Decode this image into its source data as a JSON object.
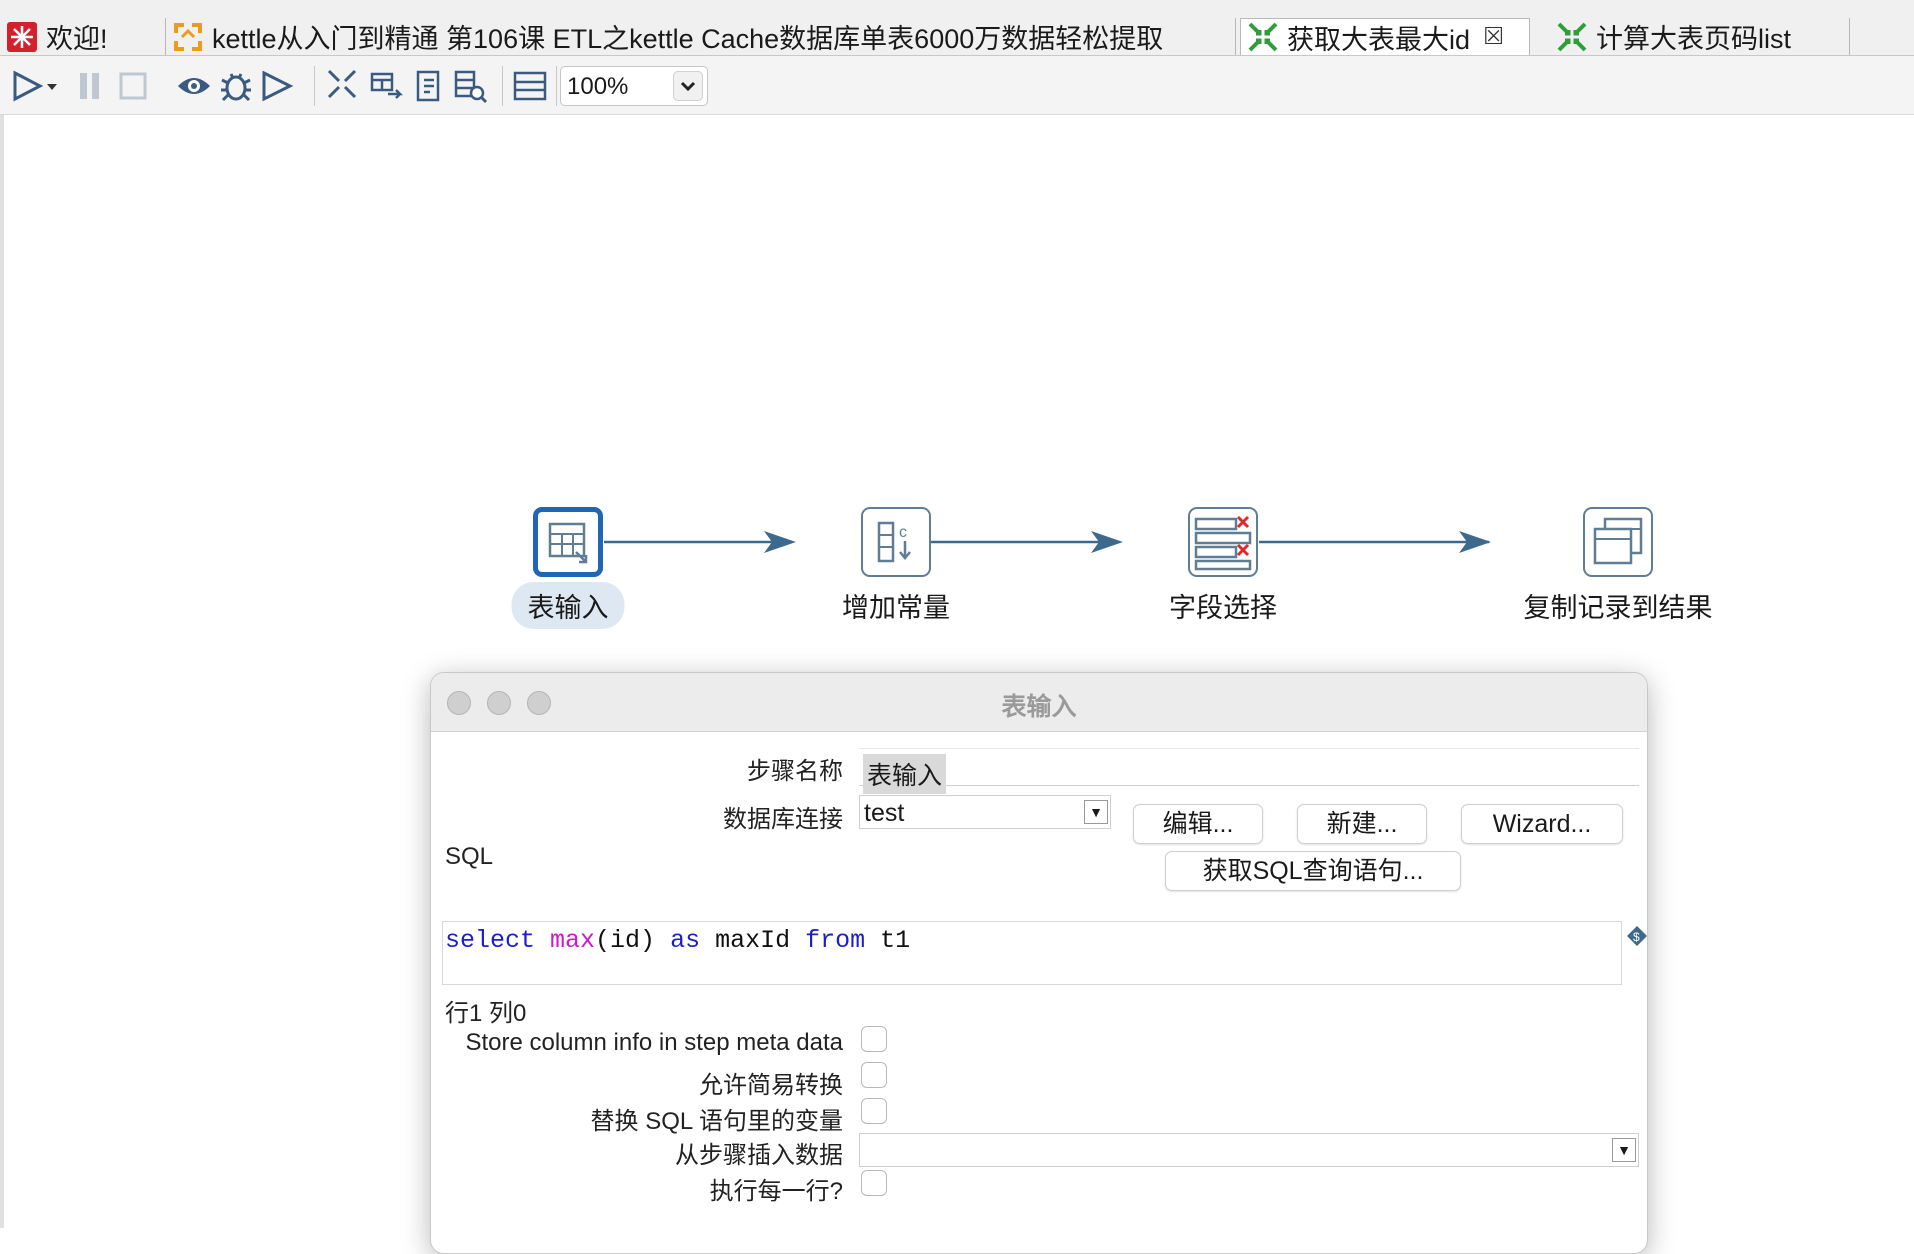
{
  "tabs": [
    {
      "label": "欢迎!",
      "icon": "spoon-welcome-icon"
    },
    {
      "label": "kettle从入门到精通 第106课 ETL之kettle Cache数据库单表6000万数据轻松提取",
      "icon": "job-icon"
    },
    {
      "label": "获取大表最大id",
      "icon": "transformation-icon",
      "active": true
    },
    {
      "label": "计算大表页码list",
      "icon": "transformation-icon"
    }
  ],
  "toolbar": {
    "zoom_value": "100%",
    "icons": [
      "run-icon",
      "dropdown-arrow-icon",
      "pause-icon",
      "stop-icon",
      "preview-icon",
      "debug-icon",
      "replay-icon",
      "verify-icon",
      "impact-icon",
      "generate-sql-icon",
      "explore-db-icon",
      "show-results-icon"
    ]
  },
  "canvas": {
    "steps": [
      {
        "label": "表输入",
        "icon": "table-input-icon",
        "selected": true
      },
      {
        "label": "增加常量",
        "icon": "add-constants-icon"
      },
      {
        "label": "字段选择",
        "icon": "select-values-icon"
      },
      {
        "label": "复制记录到结果",
        "icon": "copy-rows-to-result-icon"
      }
    ]
  },
  "dialog": {
    "title": "表输入",
    "step_name_label": "步骤名称",
    "step_name_value": "表输入",
    "db_conn_label": "数据库连接",
    "db_conn_value": "test",
    "edit_btn": "编辑...",
    "new_btn": "新建...",
    "wizard_btn": "Wizard...",
    "sql_label": "SQL",
    "get_sql_btn": "获取SQL查询语句...",
    "sql": {
      "t1": "select",
      "t2": " ",
      "t3": "max",
      "t4": "(id) ",
      "t5": "as",
      "t6": " maxId ",
      "t7": "from",
      "t8": " t1"
    },
    "position": "行1 列0",
    "store_column_info_label": "Store column info in step meta data",
    "lazy_conversion_label": "允许简易转换",
    "replace_vars_label": "替换 SQL 语句里的变量",
    "insert_from_step_label": "从步骤插入数据",
    "insert_from_step_value": "",
    "execute_each_row_label": "执行每一行?"
  },
  "colors": {
    "keyword": "#1d1dc9",
    "function": "#cc19cc",
    "hop": "#3d6a8c",
    "selected_border": "#1f66b5"
  }
}
